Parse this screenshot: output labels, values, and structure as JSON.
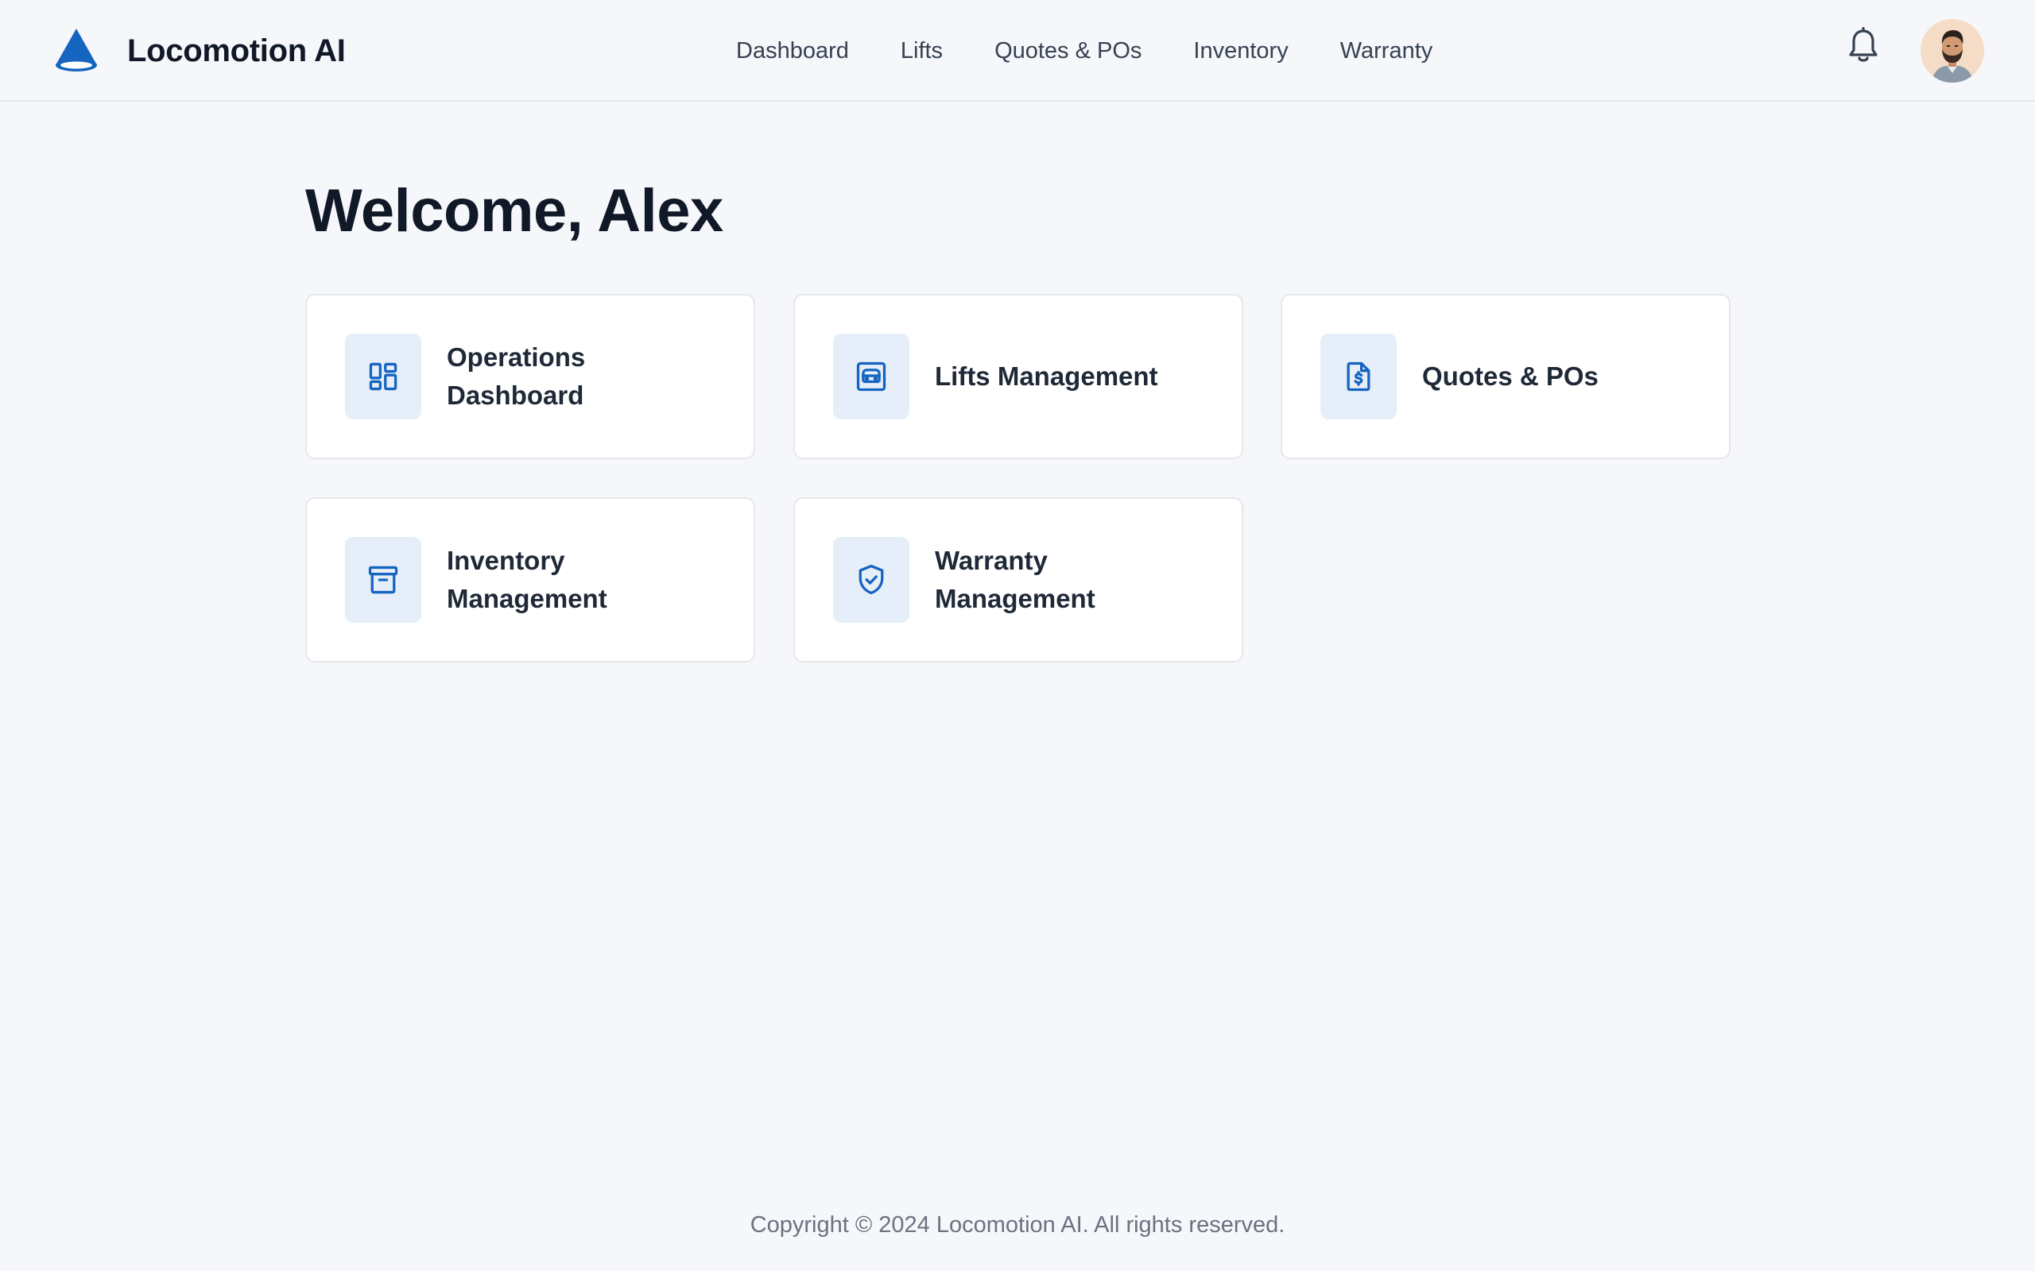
{
  "header": {
    "brand_name": "Locomotion AI",
    "brand_icon": "cone-logo-icon",
    "nav": [
      {
        "label": "Dashboard"
      },
      {
        "label": "Lifts"
      },
      {
        "label": "Quotes & POs"
      },
      {
        "label": "Inventory"
      },
      {
        "label": "Warranty"
      }
    ],
    "notifications_icon": "bell-icon",
    "avatar_icon": "user-avatar"
  },
  "main": {
    "welcome": "Welcome, Alex",
    "cards": [
      {
        "label": "Operations Dashboard",
        "icon": "dashboard-icon"
      },
      {
        "label": "Lifts Management",
        "icon": "elevator-icon"
      },
      {
        "label": "Quotes & POs",
        "icon": "invoice-dollar-icon"
      },
      {
        "label": "Inventory Management",
        "icon": "archive-box-icon"
      },
      {
        "label": "Warranty Management",
        "icon": "shield-check-icon"
      }
    ]
  },
  "footer": {
    "copyright": "Copyright © 2024 Locomotion AI. All rights reserved."
  },
  "colors": {
    "accent": "#1565c0",
    "icon_bg": "#e6eef9",
    "page_bg": "#f5f7fa",
    "card_border": "#e5e7eb"
  }
}
